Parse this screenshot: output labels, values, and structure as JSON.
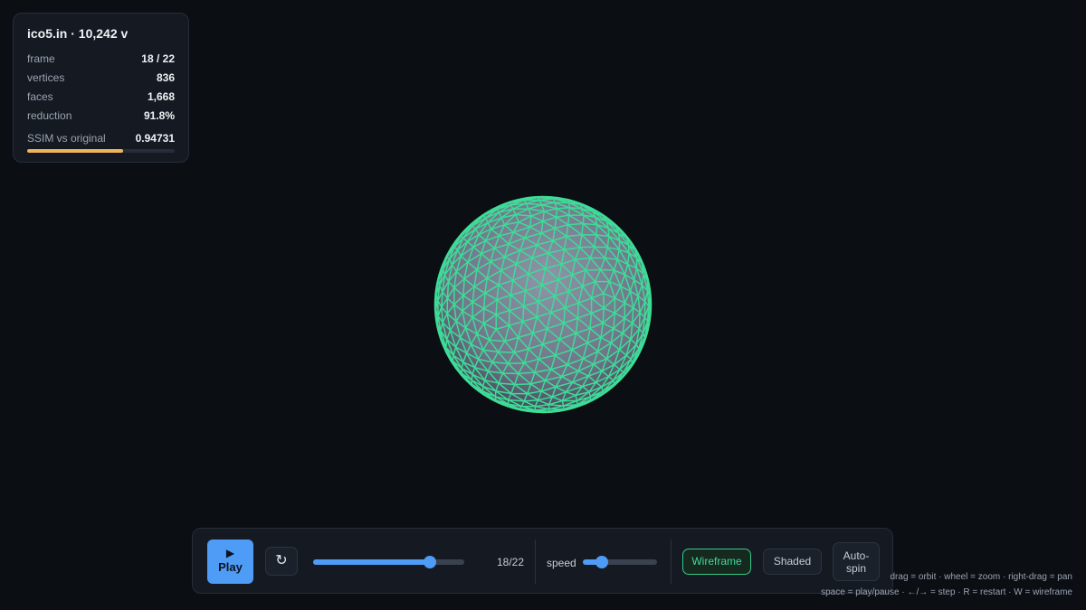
{
  "stats": {
    "title": "ico5.in · 10,242 v",
    "rows": [
      {
        "label": "frame",
        "value": "18 / 22"
      },
      {
        "label": "vertices",
        "value": "836"
      },
      {
        "label": "faces",
        "value": "1,668"
      },
      {
        "label": "reduction",
        "value": "91.8%"
      }
    ],
    "ssim": {
      "label": "SSIM vs original",
      "value": "0.94731",
      "bar_fraction": 0.65,
      "bar_color": "#f2b45a"
    }
  },
  "mesh": {
    "wire_color": "#3ddc97",
    "shade_color": "#8e95a8"
  },
  "controls": {
    "play": {
      "icon": "play-icon",
      "label": "Play"
    },
    "restart_icon": "restart-icon",
    "frame": {
      "current": 18,
      "total": 22,
      "readout": "18/22"
    },
    "speed": {
      "label": "speed",
      "fraction": 0.25
    },
    "wireframe_label": "Wireframe",
    "shaded_label": "Shaded",
    "autospin_line1": "Auto-",
    "autospin_line2": "spin",
    "accent": "#4e9cf5"
  },
  "help": {
    "line1": "drag = orbit · wheel = zoom · right-drag = pan",
    "line2": "space = play/pause · ←/→ = step · R = restart · W = wireframe"
  }
}
